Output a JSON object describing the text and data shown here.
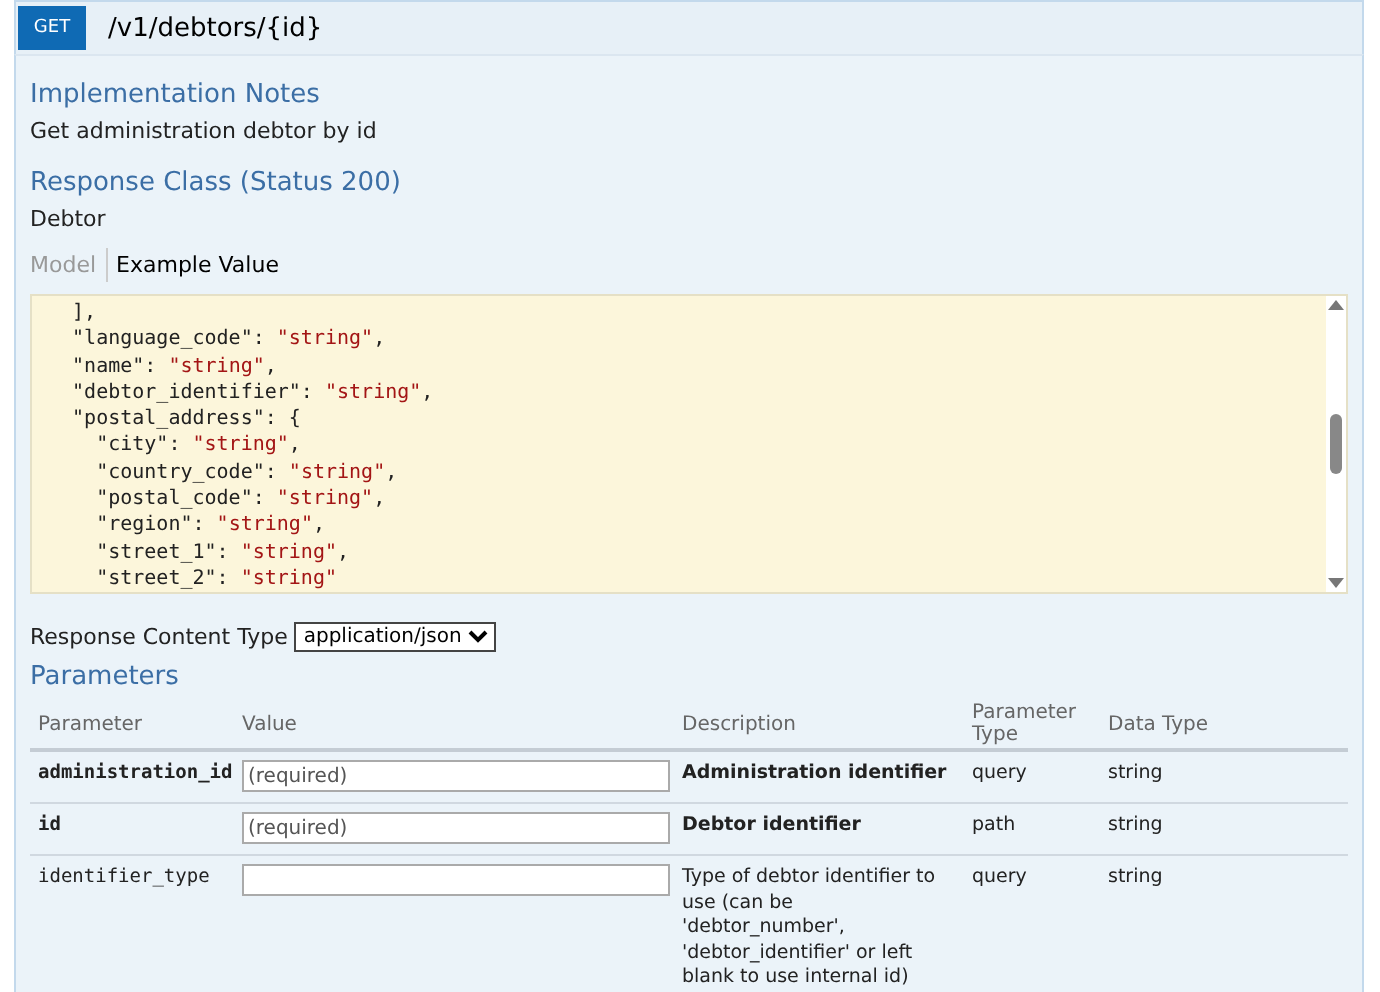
{
  "operation": {
    "method": "GET",
    "path": "/v1/debtors/{id}"
  },
  "implementation_notes": {
    "heading": "Implementation Notes",
    "text": "Get administration debtor by id"
  },
  "response_class": {
    "heading": "Response Class (Status 200)",
    "text": "Debtor"
  },
  "model_tabs": [
    {
      "label": "Model",
      "selected": false
    },
    {
      "label": "Example Value",
      "selected": true
    }
  ],
  "example_lines": [
    {
      "text": "  ],"
    },
    {
      "text": "  \"language_code\": ",
      "value": "\"string\"",
      "punct": ","
    },
    {
      "text": "  \"name\": ",
      "value": "\"string\"",
      "punct": ","
    },
    {
      "text": "  \"debtor_identifier\": ",
      "value": "\"string\"",
      "punct": ","
    },
    {
      "text": "  \"postal_address\": {"
    },
    {
      "text": "    \"city\": ",
      "value": "\"string\"",
      "punct": ","
    },
    {
      "text": "    \"country_code\": ",
      "value": "\"string\"",
      "punct": ","
    },
    {
      "text": "    \"postal_code\": ",
      "value": "\"string\"",
      "punct": ","
    },
    {
      "text": "    \"region\": ",
      "value": "\"string\"",
      "punct": ","
    },
    {
      "text": "    \"street_1\": ",
      "value": "\"string\"",
      "punct": ","
    },
    {
      "text": "    \"street_2\": ",
      "value": "\"string\""
    }
  ],
  "response_content_type": {
    "label": "Response Content Type",
    "value": "application/json"
  },
  "parameters": {
    "heading": "Parameters",
    "columns": [
      "Parameter",
      "Value",
      "Description",
      "Parameter Type",
      "Data Type"
    ],
    "rows": [
      {
        "name": "administration_id",
        "required": true,
        "placeholder": "(required)",
        "description": "Administration identifier",
        "parameter_type": "query",
        "data_type": "string"
      },
      {
        "name": "id",
        "required": true,
        "placeholder": "(required)",
        "description": "Debtor identifier",
        "parameter_type": "path",
        "data_type": "string"
      },
      {
        "name": "identifier_type",
        "required": false,
        "description": "Type of debtor identifier to use (can be 'debtor_number', 'debtor_identifier' or left blank to use internal id)",
        "parameter_type": "query",
        "data_type": "string"
      }
    ]
  }
}
